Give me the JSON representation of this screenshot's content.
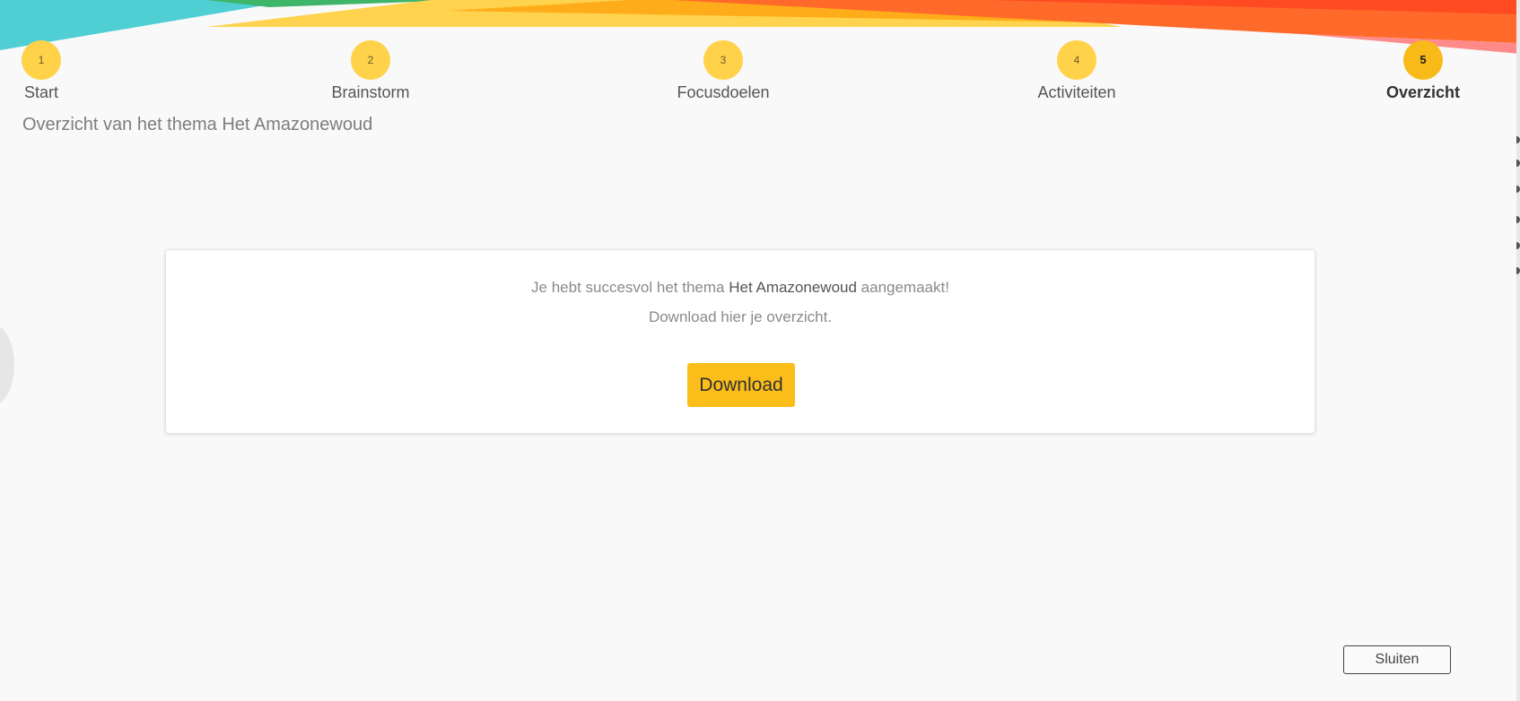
{
  "steps": [
    {
      "number": "1",
      "label": "Start"
    },
    {
      "number": "2",
      "label": "Brainstorm"
    },
    {
      "number": "3",
      "label": "Focusdoelen"
    },
    {
      "number": "4",
      "label": "Activiteiten"
    },
    {
      "number": "5",
      "label": "Overzicht"
    }
  ],
  "active_step": "5",
  "page_title": "Overzicht van het thema Het Amazonewoud",
  "card": {
    "success_prefix": "Je hebt succesvol het thema",
    "theme_name": "Het Amazonewoud",
    "success_suffix": "aangemaakt!",
    "download_hint": "Download hier je overzicht.",
    "download_label": "Download"
  },
  "close_label": "Sluiten",
  "colors": {
    "step_circle": "#ffd24a",
    "active_step_circle": "#f7ba18",
    "download_button": "#fbbd19",
    "banner_teal": "#4fcfd3",
    "banner_orange": "#ff6a2a",
    "background": "#f9f9f9"
  }
}
